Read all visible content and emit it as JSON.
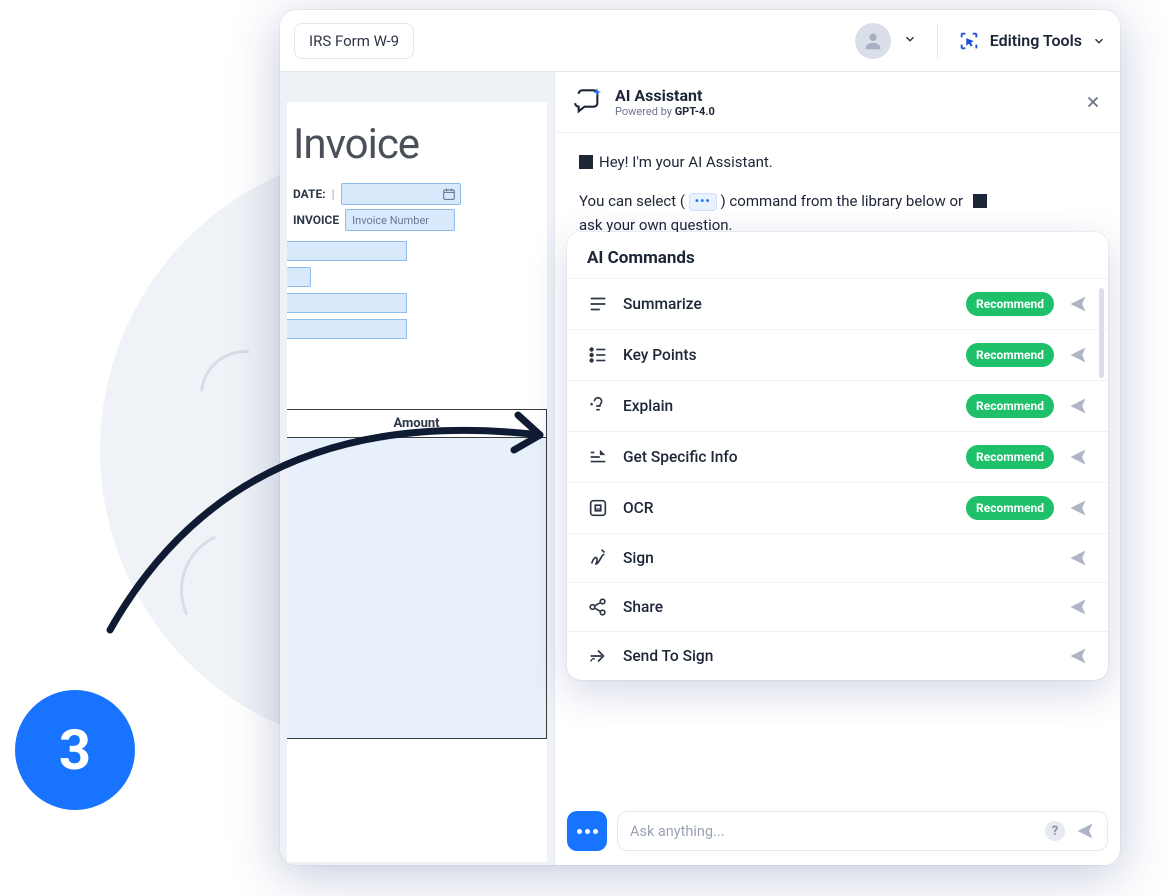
{
  "step_number": "3",
  "topbar": {
    "doc_name": "IRS Form W-9",
    "editing_tools_label": "Editing Tools"
  },
  "doc": {
    "title": "Invoice",
    "date_label": "DATE:",
    "invoice_label": "INVOICE",
    "invoice_placeholder": "Invoice Number",
    "amount_header": "Amount"
  },
  "ai": {
    "title": "AI Assistant",
    "powered_prefix": "Powered by ",
    "powered_model": "GPT-4.0",
    "greeting": "Hey! I'm your AI Assistant.",
    "hint_before": "You can select (",
    "hint_after": ") command from the library below or",
    "hint_line2": "ask your own question.",
    "commands_title": "AI Commands",
    "ask_placeholder": "Ask anything...",
    "recommend_label": "Recommend"
  },
  "commands": [
    {
      "label": "Summarize",
      "recommend": true,
      "icon": "summarize"
    },
    {
      "label": "Key Points",
      "recommend": true,
      "icon": "keypoints"
    },
    {
      "label": "Explain",
      "recommend": true,
      "icon": "explain"
    },
    {
      "label": "Get Specific Info",
      "recommend": true,
      "icon": "specific"
    },
    {
      "label": "OCR",
      "recommend": true,
      "icon": "ocr"
    },
    {
      "label": "Sign",
      "recommend": false,
      "icon": "sign"
    },
    {
      "label": "Share",
      "recommend": false,
      "icon": "share"
    },
    {
      "label": "Send To Sign",
      "recommend": false,
      "icon": "sendtosign"
    }
  ]
}
